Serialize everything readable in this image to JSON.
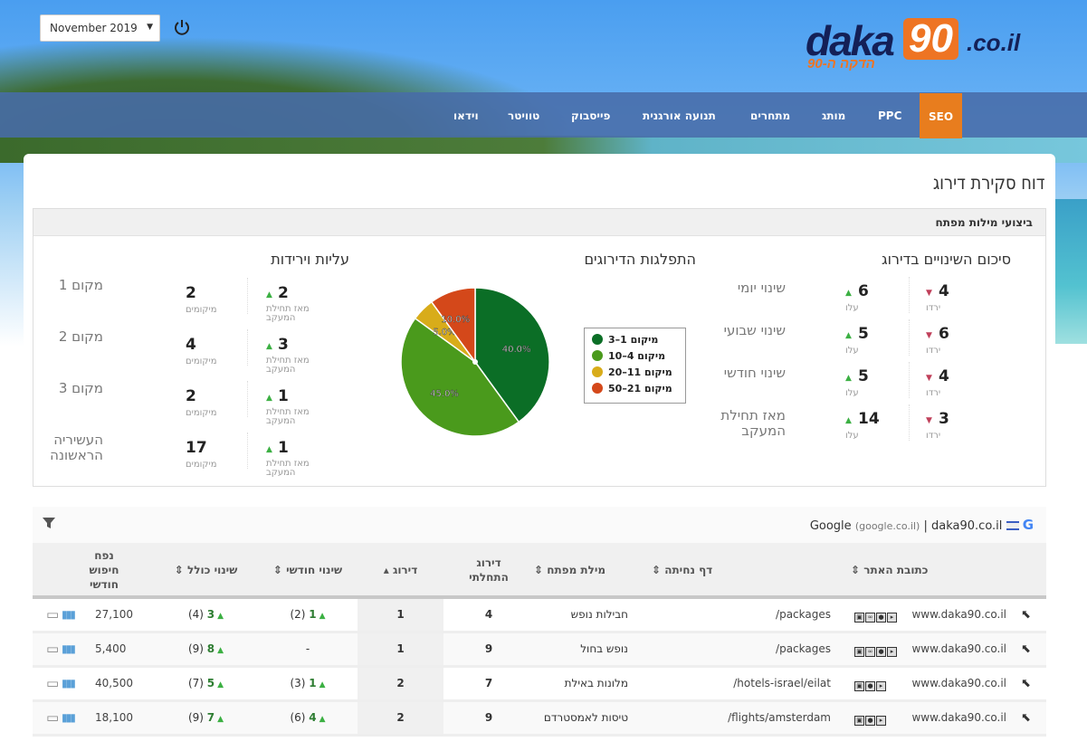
{
  "header": {
    "month_select": "November 2019",
    "logo_text": "daka90.co.il",
    "logo_tagline": "הדקה ה-90"
  },
  "nav": [
    {
      "label": "SEO",
      "active": true
    },
    {
      "label": "PPC"
    },
    {
      "label": "מותג"
    },
    {
      "label": "מתחרים"
    },
    {
      "label": "תנועה אורגנית"
    },
    {
      "label": "פייסבוק"
    },
    {
      "label": "טוויטר"
    },
    {
      "label": "וידאו"
    }
  ],
  "page_title": "דוח סקירת דירוג",
  "panel_title": "ביצועי מילות מפתח",
  "summary": {
    "title": "סיכום השינויים בדירוג",
    "up_label": "עלו",
    "down_label": "ירדו",
    "rows": [
      {
        "label": "שינוי יומי",
        "up": "6",
        "down": "4"
      },
      {
        "label": "שינוי שבועי",
        "up": "5",
        "down": "6"
      },
      {
        "label": "שינוי חודשי",
        "up": "5",
        "down": "4"
      },
      {
        "label": "מאז תחילת המעקב",
        "up": "14",
        "down": "3"
      }
    ]
  },
  "distribution": {
    "title": "התפלגות הדירוגים"
  },
  "chart_data": {
    "type": "pie",
    "title": "התפלגות הדירוגים",
    "legend": "right",
    "slices": [
      {
        "name": "מיקום 1–3",
        "value": 40.0,
        "label": "40.0%",
        "color": "#0b6e26"
      },
      {
        "name": "מיקום 4–10",
        "value": 45.0,
        "label": "45.0%",
        "color": "#4a9a1c"
      },
      {
        "name": "מיקום 11–20",
        "value": 5.0,
        "label": "5.0%",
        "color": "#d8ac1a"
      },
      {
        "name": "מיקום 21–50",
        "value": 10.0,
        "label": "10.0%",
        "color": "#d4481a"
      }
    ]
  },
  "risesfalls": {
    "title": "עליות וירידות",
    "count_label": "מיקומים",
    "since_label": "מאז תחילת המעקב",
    "rows": [
      {
        "label": "מקום 1",
        "count": "2",
        "change": "2"
      },
      {
        "label": "מקום 2",
        "count": "4",
        "change": "3"
      },
      {
        "label": "מקום 3",
        "count": "2",
        "change": "1"
      },
      {
        "label": "העשיריה הראשונה",
        "count": "17",
        "change": "1"
      }
    ]
  },
  "table": {
    "engine": "Google",
    "engine_domain": "(google.co.il)",
    "separator": "|",
    "site": "daka90.co.il",
    "headers": {
      "site": "כתובת האתר",
      "landing": "דף נחיתה",
      "keyword": "מילת מפתח",
      "initial": "דירוג התחלתי",
      "rank": "דירוג",
      "monthly": "שינוי חודשי",
      "total": "שינוי כולל",
      "volume": "נפח חיפוש חודשי"
    },
    "rows": [
      {
        "site": "www.daka90.co.il",
        "icons": [
          "page",
          "link",
          "lock",
          "video"
        ],
        "landing": "/packages",
        "keyword": "חבילות נופש",
        "initial": "4",
        "rank": "1",
        "monthly": "1",
        "monthly_prev": "(2)",
        "total": "3",
        "total_prev": "(4)",
        "volume": "27,100"
      },
      {
        "site": "www.daka90.co.il",
        "icons": [
          "page",
          "link",
          "lock",
          "video"
        ],
        "landing": "/packages",
        "keyword": "נופש בחול",
        "initial": "9",
        "rank": "1",
        "monthly": "-",
        "monthly_prev": "",
        "total": "8",
        "total_prev": "(9)",
        "volume": "5,400"
      },
      {
        "site": "www.daka90.co.il",
        "icons": [
          "page",
          "lock",
          "video"
        ],
        "landing": "/hotels-israel/eilat",
        "keyword": "מלונות באילת",
        "initial": "7",
        "rank": "2",
        "monthly": "1",
        "monthly_prev": "(3)",
        "total": "5",
        "total_prev": "(7)",
        "volume": "40,500"
      },
      {
        "site": "www.daka90.co.il",
        "icons": [
          "page",
          "lock",
          "video"
        ],
        "landing": "/flights/amsterdam",
        "keyword": "טיסות לאמסטרדם",
        "initial": "9",
        "rank": "2",
        "monthly": "4",
        "monthly_prev": "(6)",
        "total": "7",
        "total_prev": "(9)",
        "volume": "18,100"
      }
    ]
  }
}
